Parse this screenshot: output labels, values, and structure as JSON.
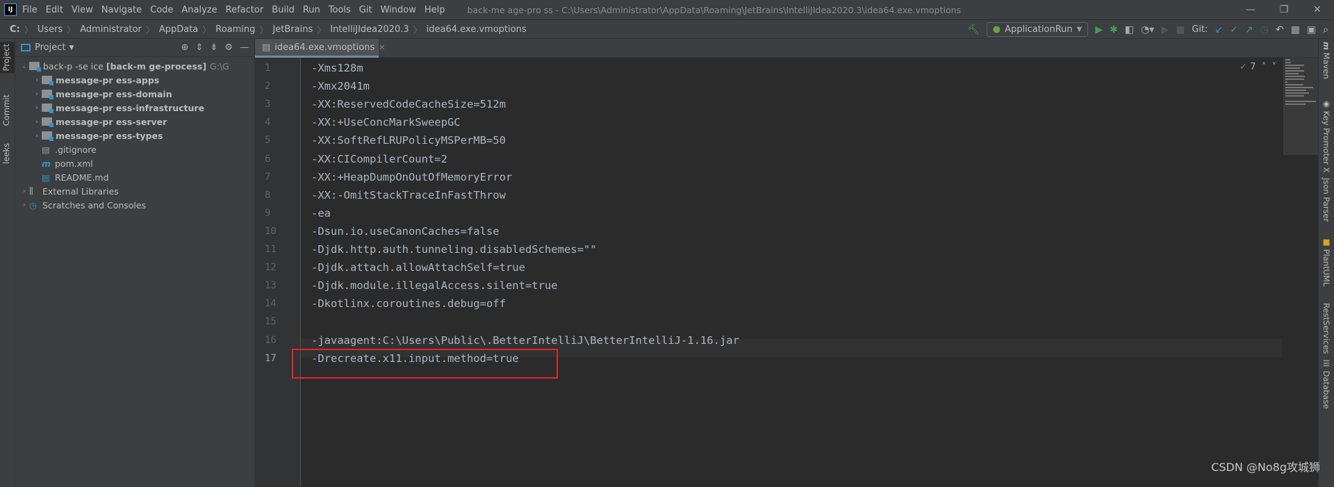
{
  "title_bar": {
    "logo": "IJ",
    "menu": [
      "File",
      "Edit",
      "View",
      "Navigate",
      "Code",
      "Analyze",
      "Refactor",
      "Build",
      "Run",
      "Tools",
      "Git",
      "Window",
      "Help"
    ],
    "window_title": "back-me  age-pro  ss - C:\\Users\\Administrator\\AppData\\Roaming\\JetBrains\\IntelliJIdea2020.3\\idea64.exe.vmoptions"
  },
  "breadcrumb": [
    "C:",
    "Users",
    "Administrator",
    "AppData",
    "Roaming",
    "JetBrains",
    "IntelliJIdea2020.3",
    "idea64.exe.vmoptions"
  ],
  "toolbar": {
    "run_config": "ApplicationRun",
    "git_label": "Git:"
  },
  "left_strip": [
    "Project",
    "Commit",
    "leeks"
  ],
  "project_panel": {
    "title": "Project",
    "tree": [
      {
        "label": "back-p      -se   ice",
        "bold_suffix": "[back-m      ge-process]",
        "path": "G:\\G",
        "level": 0,
        "expanded": true
      },
      {
        "label": "message-pr   ess-apps",
        "level": 1,
        "type": "module"
      },
      {
        "label": "message-pr   ess-domain",
        "level": 1,
        "type": "module"
      },
      {
        "label": "message-pr   ess-infrastructure",
        "level": 1,
        "type": "module"
      },
      {
        "label": "message-pr   ess-server",
        "level": 1,
        "type": "module"
      },
      {
        "label": "message-pr   ess-types",
        "level": 1,
        "type": "module"
      },
      {
        "label": ".gitignore",
        "level": 1,
        "type": "file"
      },
      {
        "label": "pom.xml",
        "level": 1,
        "type": "maven"
      },
      {
        "label": "README.md",
        "level": 1,
        "type": "md"
      },
      {
        "label": "External Libraries",
        "level": 0,
        "type": "lib"
      },
      {
        "label": "Scratches and Consoles",
        "level": 0,
        "type": "scratch"
      }
    ]
  },
  "editor": {
    "tab": "idea64.exe.vmoptions",
    "inspection_count": "7",
    "current_line": 17,
    "lines": [
      "-Xms128m",
      "-Xmx2041m",
      "-XX:ReservedCodeCacheSize=512m",
      "-XX:+UseConcMarkSweepGC",
      "-XX:SoftRefLRUPolicyMSPerMB=50",
      "-XX:CICompilerCount=2",
      "-XX:+HeapDumpOnOutOfMemoryError",
      "-XX:-OmitStackTraceInFastThrow",
      "-ea",
      "-Dsun.io.useCanonCaches=false",
      "-Djdk.http.auth.tunneling.disabledSchemes=\"\"",
      "-Djdk.attach.allowAttachSelf=true",
      "-Djdk.module.illegalAccess.silent=true",
      "-Dkotlinx.coroutines.debug=off",
      "",
      "-javaagent:C:\\Users\\Public\\.BetterIntelliJ\\BetterIntelliJ-1.16.jar",
      "-Drecreate.x11.input.method=true"
    ]
  },
  "right_strip": [
    "Maven",
    "Key Promoter X",
    "Json Parser",
    "PlantUML",
    "RestServices",
    "Database"
  ],
  "watermark": "CSDN @No8g攻城狮",
  "colors": {
    "highlight_box": "#e0272d",
    "code_text": "#a9b7c6",
    "background": "#2b2b2b"
  }
}
